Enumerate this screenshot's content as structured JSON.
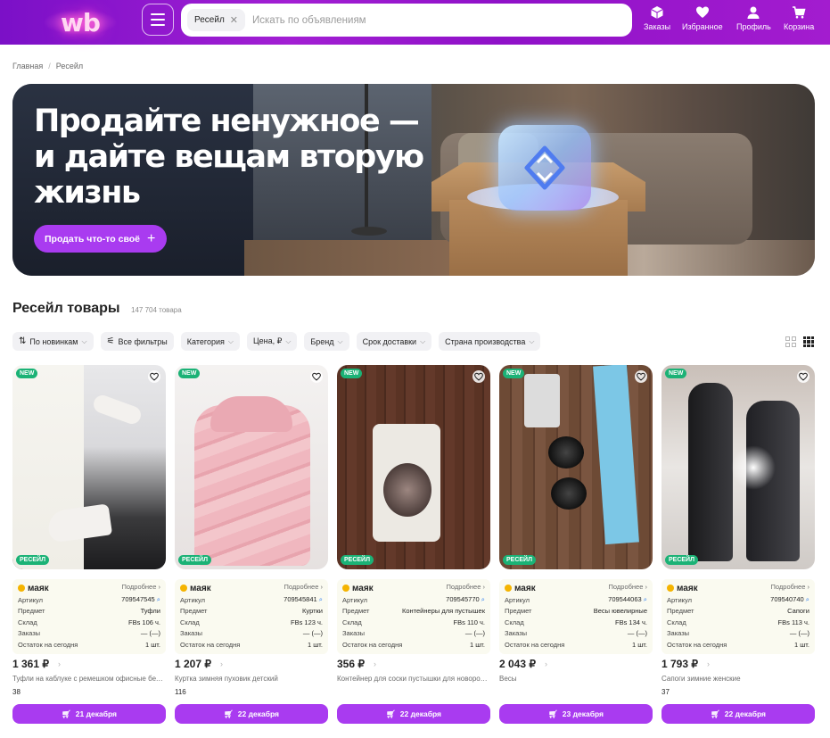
{
  "header": {
    "logo": "wb",
    "search_chip": "Ресейл",
    "search_placeholder": "Искать по объявлениям",
    "nav": [
      {
        "label": "Заказы",
        "icon": "box-icon"
      },
      {
        "label": "Избранное",
        "icon": "heart-icon"
      },
      {
        "label": "Профиль",
        "icon": "user-icon"
      },
      {
        "label": "Корзина",
        "icon": "cart-icon"
      }
    ]
  },
  "breadcrumbs": [
    "Главная",
    "Ресейл"
  ],
  "banner": {
    "headline": "Продайте ненужное — и дайте вещам вторую жизнь",
    "button": "Продать что-то своё"
  },
  "section": {
    "title": "Ресейл товары",
    "count": "147 704 товара"
  },
  "filters": [
    "По новинкам",
    "Все фильтры",
    "Категория",
    "Цена, ₽",
    "Бренд",
    "Срок доставки",
    "Страна производства"
  ],
  "labels": {
    "new": "NEW",
    "resale": "РЕСЕЙЛ",
    "brand": "маяк",
    "more": "Подробнее",
    "article": "Артикул",
    "subject": "Предмет",
    "warehouse": "Склад",
    "orders": "Заказы",
    "stock": "Остаток на сегодня"
  },
  "products": [
    {
      "article": "709547545",
      "subject": "Туфли",
      "warehouse": "FBs 106 ч.",
      "orders": "— (—)",
      "stock": "1 шт.",
      "price": "1 361 ₽",
      "title": "Туфли на каблуке с ремешком офисные белые",
      "reviews": "38",
      "delivery": "21 декабря"
    },
    {
      "article": "709545841",
      "subject": "Куртки",
      "warehouse": "FBs 123 ч.",
      "orders": "— (—)",
      "stock": "1 шт.",
      "price": "1 207 ₽",
      "title": "Куртка зимняя пуховик детский",
      "reviews": "116",
      "delivery": "22 декабря"
    },
    {
      "article": "709545770",
      "subject": "Контейнеры для пустышек",
      "warehouse": "FBs 110 ч.",
      "orders": "— (—)",
      "stock": "1 шт.",
      "price": "356 ₽",
      "title": "Контейнер для соски пустышки для новорожденных",
      "reviews": "",
      "delivery": "22 декабря"
    },
    {
      "article": "709544063",
      "subject": "Весы ювелирные",
      "warehouse": "FBs 134 ч.",
      "orders": "— (—)",
      "stock": "1 шт.",
      "price": "2 043 ₽",
      "title": "Весы",
      "reviews": "",
      "delivery": "23 декабря"
    },
    {
      "article": "709540740",
      "subject": "Сапоги",
      "warehouse": "FBs 113 ч.",
      "orders": "— (—)",
      "stock": "1 шт.",
      "price": "1 793 ₽",
      "title": "Сапоги зимние женские",
      "reviews": "37",
      "delivery": "22 декабря"
    }
  ]
}
